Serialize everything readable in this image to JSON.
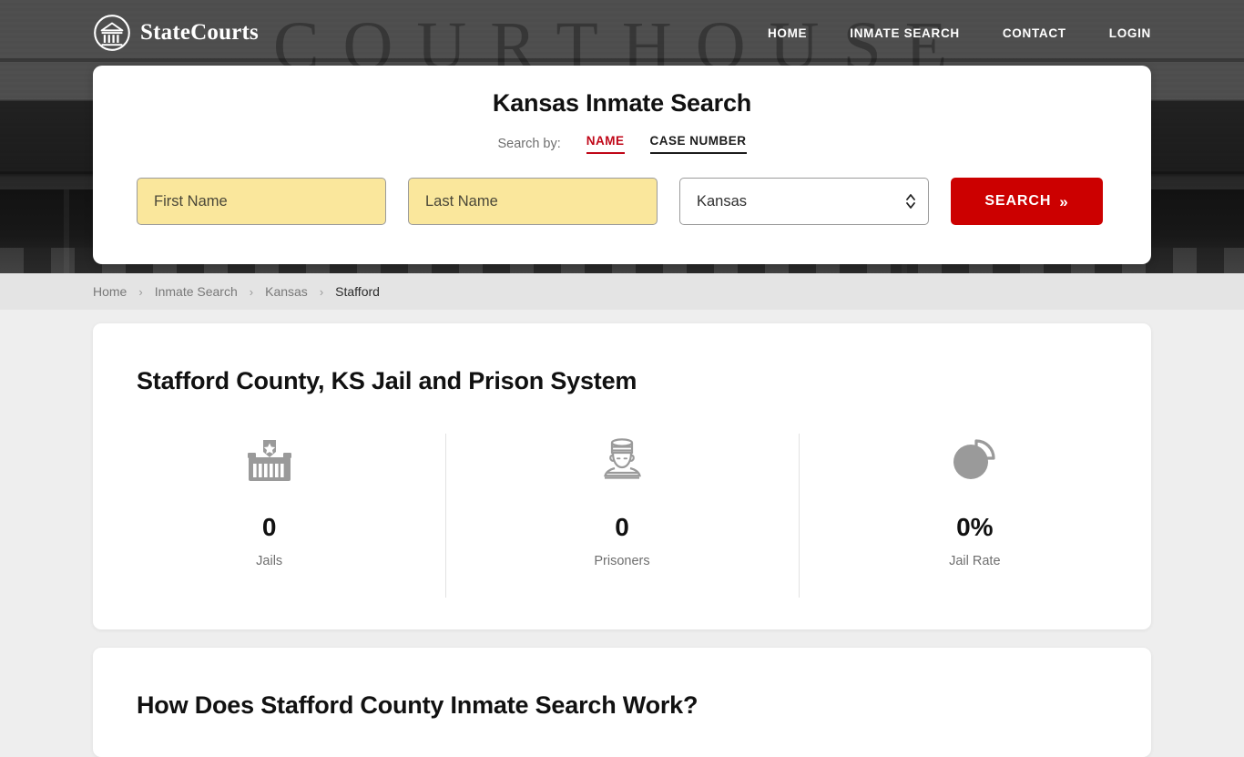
{
  "brand": {
    "name": "StateCourts",
    "logo_icon": "courthouse-circle-icon"
  },
  "nav": {
    "items": [
      {
        "label": "HOME"
      },
      {
        "label": "INMATE SEARCH"
      },
      {
        "label": "CONTACT"
      },
      {
        "label": "LOGIN"
      }
    ]
  },
  "search": {
    "title": "Kansas Inmate Search",
    "search_by_label": "Search by:",
    "tabs": [
      {
        "label": "NAME",
        "active": true
      },
      {
        "label": "CASE NUMBER",
        "active": false
      }
    ],
    "first_name_placeholder": "First Name",
    "first_name_value": "",
    "last_name_placeholder": "Last Name",
    "last_name_value": "",
    "state_selected": "Kansas",
    "button_label": "SEARCH",
    "button_chevron": "»",
    "accent_red": "#cc0000",
    "tab_active_red": "#c00718",
    "input_fill": "#fae79c"
  },
  "breadcrumb": {
    "items": [
      {
        "label": "Home"
      },
      {
        "label": "Inmate Search"
      },
      {
        "label": "Kansas"
      },
      {
        "label": "Stafford"
      }
    ],
    "separator": "›"
  },
  "hero": {
    "background_word": "COURTHOUSE"
  },
  "county": {
    "title": "Stafford County, KS Jail and Prison System",
    "stats": [
      {
        "value": "0",
        "label": "Jails",
        "icon": "jail-building-icon"
      },
      {
        "value": "0",
        "label": "Prisoners",
        "icon": "prisoner-icon"
      },
      {
        "value": "0%",
        "label": "Jail Rate",
        "icon": "pie-chart-icon"
      }
    ]
  },
  "next_section": {
    "heading": "How Does Stafford County Inmate Search Work?"
  }
}
